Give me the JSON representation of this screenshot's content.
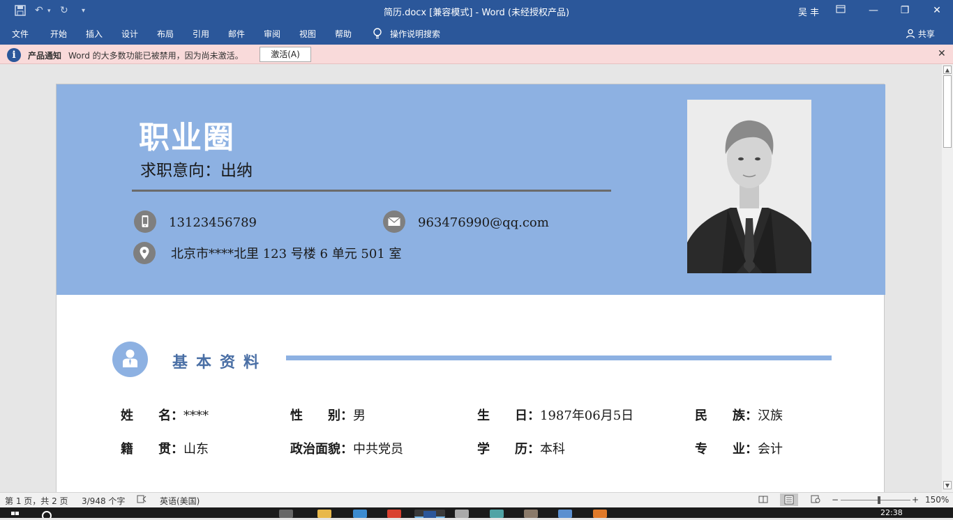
{
  "titlebar": {
    "title": "简历.docx [兼容模式]  -  Word (未经授权产品)",
    "user": "吴 丰",
    "quick_access": [
      "save-icon",
      "undo-icon",
      "redo-icon",
      "customize-icon"
    ]
  },
  "menu": {
    "items": [
      "文件",
      "开始",
      "插入",
      "设计",
      "布局",
      "引用",
      "邮件",
      "审阅",
      "视图",
      "帮助"
    ],
    "tellme": "操作说明搜索",
    "share": "共享"
  },
  "notify": {
    "title": "产品通知",
    "message": "Word 的大多数功能已被禁用，因为尚未激活。",
    "button": "激活(A)"
  },
  "resume": {
    "name": "职业圈",
    "objective": "求职意向：出纳",
    "phone": "13123456789",
    "email": "963476990@qq.com",
    "address": "北京市****北里 123 号楼 6 单元 501 室",
    "section_title": "基本资料",
    "fields": [
      {
        "label": "姓　　名：",
        "value": "****"
      },
      {
        "label": "性　　别：",
        "value": "男"
      },
      {
        "label": "生　　日：",
        "value": "1987年06月5日"
      },
      {
        "label": "民　　族：",
        "value": "汉族"
      },
      {
        "label": "籍　　贯：",
        "value": "山东"
      },
      {
        "label": "政治面貌：",
        "value": "中共党员"
      },
      {
        "label": "学　　历：",
        "value": "本科"
      },
      {
        "label": "专　　业：",
        "value": "会计"
      }
    ]
  },
  "status": {
    "page": "第 1 页，共 2 页",
    "words": "3/948 个字",
    "language": "英语(美国)",
    "zoom": "150%"
  },
  "taskbar": {
    "time": "22:38"
  },
  "colors": {
    "ribbon": "#2b579a",
    "header_band": "#8db1e2",
    "notify_bg": "#f9dada"
  }
}
